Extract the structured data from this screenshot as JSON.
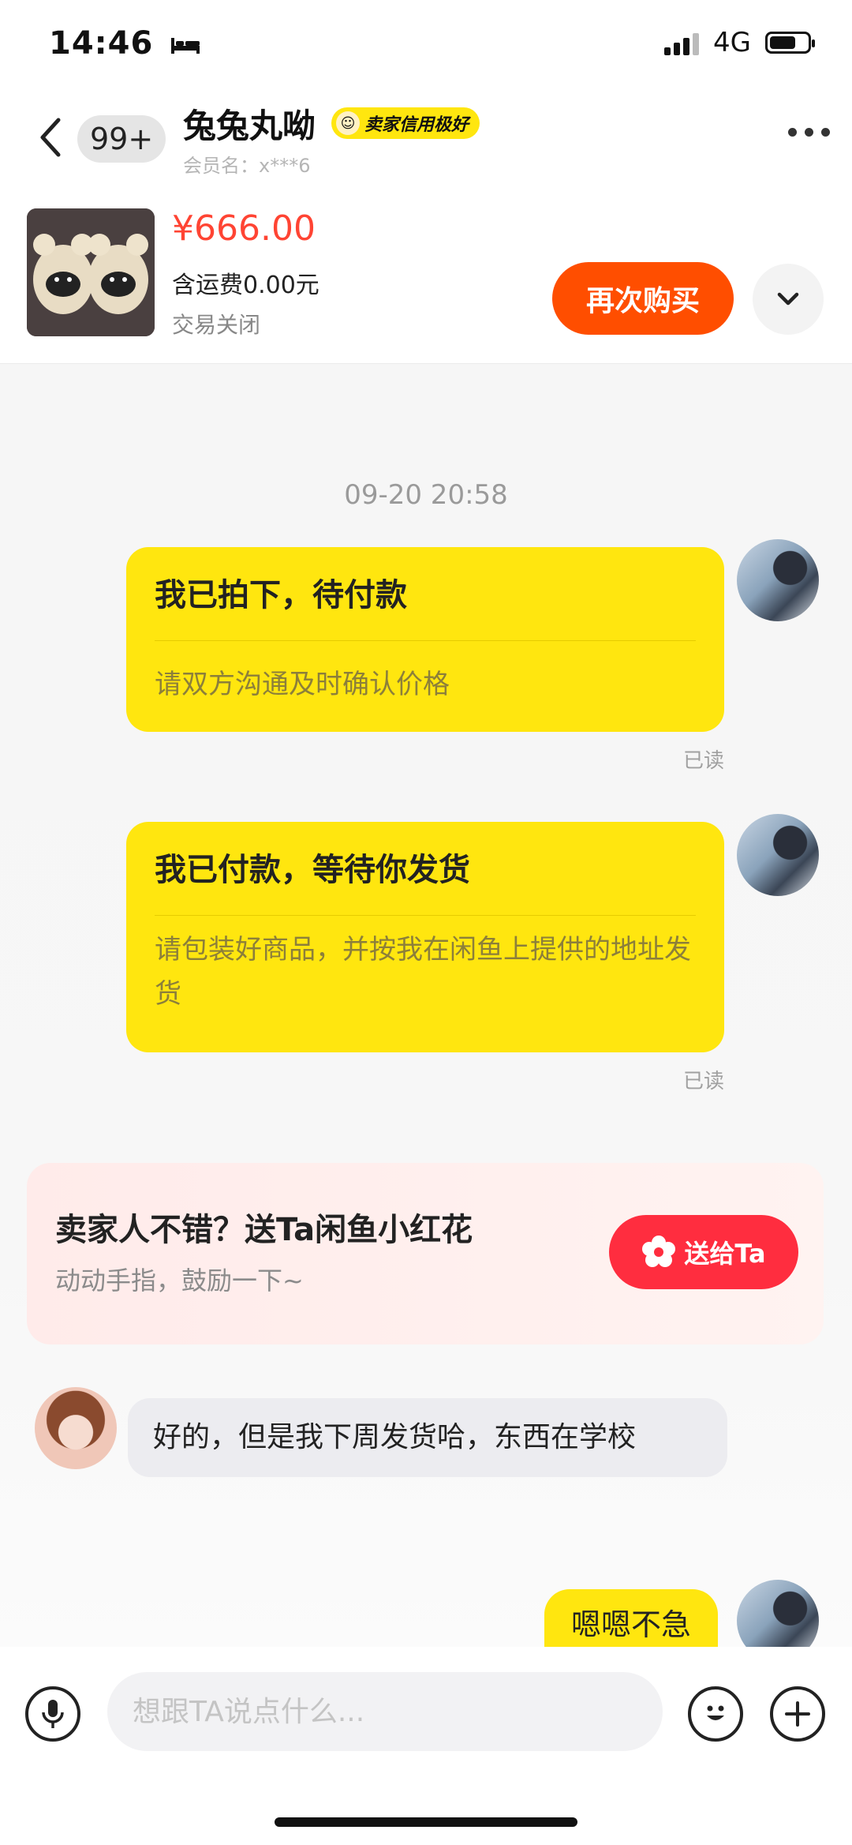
{
  "status": {
    "time": "14:46",
    "network": "4G",
    "battery_level": 0.7
  },
  "header": {
    "unread": "99+",
    "seller_name": "兔兔丸呦",
    "credit_badge": "卖家信用极好",
    "member_id": "会员名：x***6"
  },
  "product": {
    "price": "¥666.00",
    "shipping": "含运费0.00元",
    "status": "交易关闭",
    "rebuy_label": "再次购买"
  },
  "chat": {
    "timestamp": "09-20 20:58",
    "card1": {
      "title": "我已拍下，待付款",
      "desc": "请双方沟通及时确认价格",
      "read": "已读"
    },
    "card2": {
      "title": "我已付款，等待你发货",
      "desc": "请包装好商品，并按我在闲鱼上提供的地址发货",
      "read": "已读"
    },
    "flower": {
      "title": "卖家人不错？送Ta闲鱼小红花",
      "subtitle": "动动手指，鼓励一下~",
      "button": "送给Ta"
    },
    "seller_message": "好的，但是我下周发货哈，东西在学校",
    "my_message": "嗯嗯不急"
  },
  "input": {
    "placeholder": "想跟TA说点什么..."
  },
  "colors": {
    "accent_yellow": "#ffe60f",
    "price_red": "#ff4433",
    "rebuy_orange": "#ff4e00",
    "flower_red": "#ff2d3f"
  }
}
